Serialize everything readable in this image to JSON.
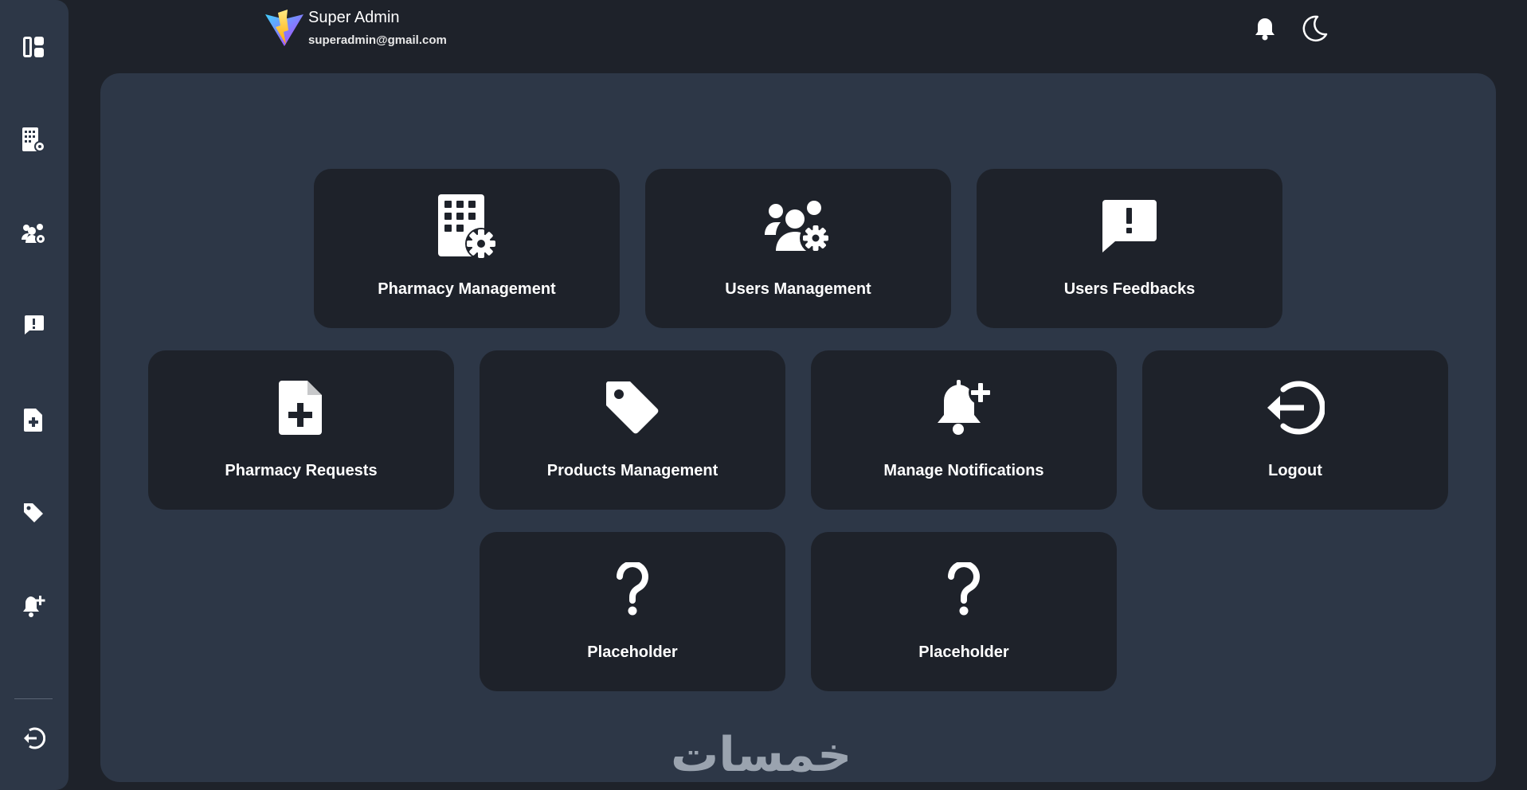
{
  "header": {
    "user_name": "Super Admin",
    "user_email": "superadmin@gmail.com"
  },
  "sidebar": {
    "items": [
      {
        "icon": "dashboard-icon"
      },
      {
        "icon": "pharmacy-icon"
      },
      {
        "icon": "users-gear-icon"
      },
      {
        "icon": "feedback-icon"
      },
      {
        "icon": "file-add-icon"
      },
      {
        "icon": "tag-icon"
      },
      {
        "icon": "bell-plus-icon"
      },
      {
        "icon": "logout-icon"
      }
    ]
  },
  "cards": [
    {
      "label": "Pharmacy Management",
      "icon": "pharmacy-gear-icon"
    },
    {
      "label": "Users Management",
      "icon": "users-gear-icon"
    },
    {
      "label": "Users Feedbacks",
      "icon": "feedback-icon"
    },
    {
      "label": "Pharmacy Requests",
      "icon": "file-add-icon"
    },
    {
      "label": "Products Management",
      "icon": "tag-icon"
    },
    {
      "label": "Manage Notifications",
      "icon": "bell-plus-icon"
    },
    {
      "label": "Logout",
      "icon": "logout-icon"
    },
    {
      "label": "Placeholder",
      "icon": "question-icon"
    },
    {
      "label": "Placeholder",
      "icon": "question-icon"
    }
  ],
  "watermark": "خمسات",
  "colors": {
    "background": "#1e222a",
    "panel": "#2d3747",
    "card": "#1e222a",
    "text": "#ffffff"
  }
}
